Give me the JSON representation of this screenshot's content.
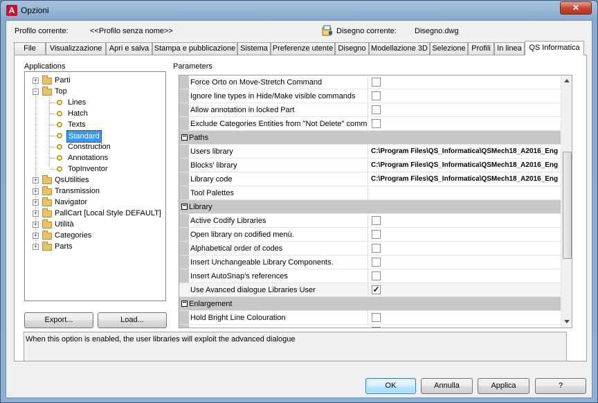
{
  "window": {
    "title": "Opzioni",
    "close_label": "✕"
  },
  "header": {
    "profile_label": "Profilo corrente:",
    "profile_value": "<<Profilo senza nome>>",
    "drawing_label": "Disegno corrente:",
    "drawing_value": "Disegno.dwg"
  },
  "tabs": [
    {
      "label": "File"
    },
    {
      "label": "Visualizzazione"
    },
    {
      "label": "Apri e salva"
    },
    {
      "label": "Stampa e pubblicazione"
    },
    {
      "label": "Sistema"
    },
    {
      "label": "Preferenze utente"
    },
    {
      "label": "Disegno"
    },
    {
      "label": "Modellazione 3D"
    },
    {
      "label": "Selezione"
    },
    {
      "label": "Profili"
    },
    {
      "label": "In linea"
    },
    {
      "label": "QS Informatica",
      "active": true
    }
  ],
  "applications": {
    "label": "Applications",
    "tree": {
      "parti": "Parti",
      "top": "Top",
      "lines": "Lines",
      "hatch": "Hatch",
      "texts": "Texts",
      "standard": "Standard",
      "construction": "Construction",
      "annotations": "Annotations",
      "topinventor": "TopInventor",
      "qsutilities": "QsUtilities",
      "transmission": "Transmission",
      "navigator": "Navigator",
      "pallcart": "PallCart [Local Style DEFAULT]",
      "utilita": "Utilità",
      "categories": "Categories",
      "parts": "Parts"
    },
    "export_label": "Export...",
    "load_label": "Load..."
  },
  "parameters": {
    "label": "Parameters",
    "rows": {
      "r0": {
        "name": "Force Orto on Move-Stretch Command",
        "checked": false
      },
      "r1": {
        "name": "Ignore line types in Hide/Make visible commands",
        "checked": false
      },
      "r2": {
        "name": "Allow annotation in locked Part",
        "checked": false
      },
      "r3": {
        "name": "Exclude Categories Entities from \"Not Delete\" commar",
        "checked": false
      },
      "c_paths": "Paths",
      "users_library": {
        "name": "Users library",
        "value": "C:\\Program Files\\QS_Informatica\\QSMech18_A2016_Eng"
      },
      "blocks_library": {
        "name": "Blocks' library",
        "value": "C:\\Program Files\\QS_Informatica\\QSMech18_A2016_Eng"
      },
      "library_code": {
        "name": "Library code",
        "value": "C:\\Program Files\\QS_Informatica\\QSMech18_A2016_Eng"
      },
      "tool_palettes": {
        "name": "Tool Palettes",
        "value": ""
      },
      "c_library": "Library",
      "l0": {
        "name": "Active Codify Libraries",
        "checked": false
      },
      "l1": {
        "name": "Open library on codified menù.",
        "checked": false
      },
      "l2": {
        "name": "Alphabetical order of codes",
        "checked": false
      },
      "l3": {
        "name": "Insert Unchangeable Library Components.",
        "checked": false
      },
      "l4": {
        "name": "Insert AutoSnap's references",
        "checked": false
      },
      "l5": {
        "name": "Use Avanced dialogue Libraries User",
        "checked": true,
        "mark": "✓"
      },
      "c_enlargement": "Enlargement",
      "e0": {
        "name": "Hold Bright Line Colouration",
        "checked": false
      }
    }
  },
  "description": "When this option is enabled, the user libraries will exploit the advanced dialogue",
  "buttons": {
    "ok": "OK",
    "annulla": "Annulla",
    "applica": "Applica",
    "help": "?"
  }
}
